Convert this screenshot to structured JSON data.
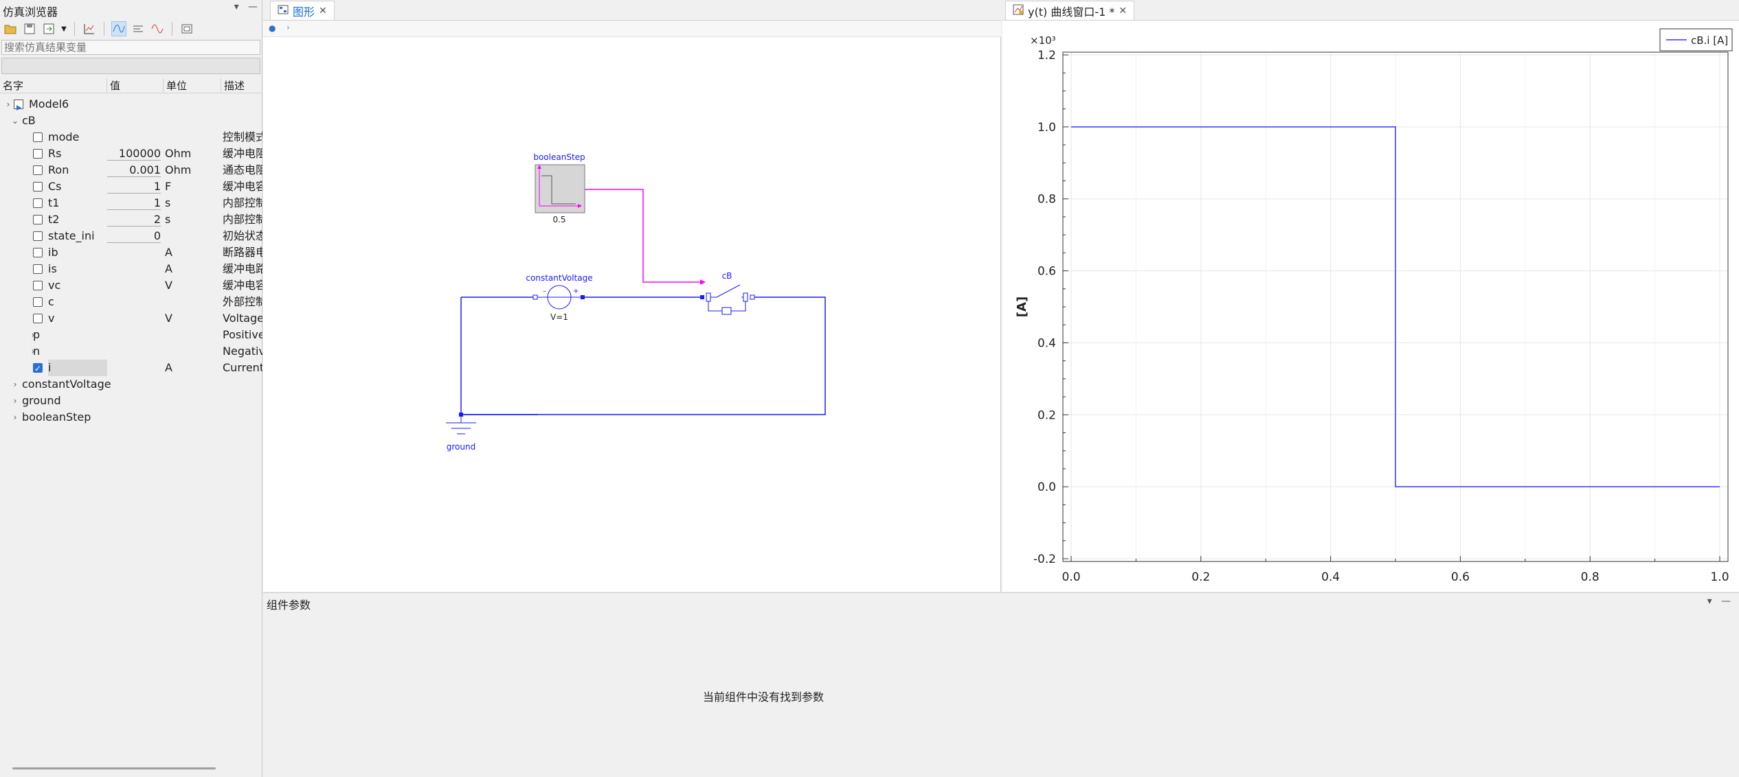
{
  "left_panel": {
    "title": "仿真浏览器",
    "search_placeholder": "搜索仿真结果变量",
    "columns": [
      "名字",
      "值",
      "单位",
      "描述"
    ],
    "tree": [
      {
        "level": 0,
        "arrow": "›",
        "name": "Model6",
        "icon": "model-icon"
      },
      {
        "level": 1,
        "arrow": "⌄",
        "name": "cB"
      },
      {
        "level": 2,
        "check": false,
        "name": "mode",
        "value": "",
        "unit": "",
        "desc": "控制模式"
      },
      {
        "level": 2,
        "check": false,
        "name": "Rs",
        "value": "100000",
        "unit": "Ohm",
        "desc": "缓冲电阻"
      },
      {
        "level": 2,
        "check": false,
        "name": "Ron",
        "value": "0.001",
        "unit": "Ohm",
        "desc": "通态电阻"
      },
      {
        "level": 2,
        "check": false,
        "name": "Cs",
        "value": "1",
        "unit": "F",
        "desc": "缓冲电容"
      },
      {
        "level": 2,
        "check": false,
        "name": "t1",
        "value": "1",
        "unit": "s",
        "desc": "内部控制"
      },
      {
        "level": 2,
        "check": false,
        "name": "t2",
        "value": "2",
        "unit": "s",
        "desc": "内部控制"
      },
      {
        "level": 2,
        "check": false,
        "name": "state_ini",
        "value": "0",
        "unit": "",
        "desc": "初始状态"
      },
      {
        "level": 2,
        "check": false,
        "name": "ib",
        "value": "",
        "unit": "A",
        "desc": "断路器电"
      },
      {
        "level": 2,
        "check": false,
        "name": "is",
        "value": "",
        "unit": "A",
        "desc": "缓冲电路"
      },
      {
        "level": 2,
        "check": false,
        "name": "vc",
        "value": "",
        "unit": "V",
        "desc": "缓冲电容"
      },
      {
        "level": 2,
        "check": false,
        "name": "c",
        "value": "",
        "unit": "",
        "desc": "外部控制"
      },
      {
        "level": 2,
        "check": false,
        "name": "v",
        "value": "",
        "unit": "V",
        "desc": "Voltage"
      },
      {
        "level": 2,
        "arrow": "›",
        "name": "p",
        "desc": "Positive"
      },
      {
        "level": 2,
        "arrow": "›",
        "name": "n",
        "desc": "Negativ"
      },
      {
        "level": 2,
        "check": true,
        "name": "i",
        "value": "",
        "unit": "A",
        "desc": "Current",
        "highlight": true
      },
      {
        "level": 1,
        "arrow": "›",
        "name": "constantVoltage"
      },
      {
        "level": 1,
        "arrow": "›",
        "name": "ground"
      },
      {
        "level": 1,
        "arrow": "›",
        "name": "booleanStep"
      }
    ]
  },
  "diagram": {
    "tab_label": "图形",
    "labels": {
      "booleanStep": "booleanStep",
      "booleanStep_param": "0.5",
      "constantVoltage": "constantVoltage",
      "constantVoltage_param": "V=1",
      "cB": "cB",
      "ground": "ground"
    },
    "colors": {
      "wire": "#1a1aff",
      "signal": "#ff00ff"
    }
  },
  "plot": {
    "tab_label": "y(t) 曲线窗口-1 *",
    "ylabel": "[A]",
    "exponent": "×10³",
    "legend": "cB.i [A]"
  },
  "chart_data": {
    "type": "line",
    "title": "",
    "xlabel": "",
    "ylabel": "[A]",
    "xlim": [
      0.0,
      1.0
    ],
    "ylim": [
      -0.2,
      1.2
    ],
    "xticks": [
      "0.0",
      "0.2",
      "0.4",
      "0.6",
      "0.8",
      "1.0"
    ],
    "yticks": [
      "-0.2",
      "0.0",
      "0.2",
      "0.4",
      "0.6",
      "0.8",
      "1.0",
      "1.2"
    ],
    "grid": true,
    "legend_position": "top-right",
    "series": [
      {
        "name": "cB.i [A]",
        "color": "#3333ff",
        "x": [
          0.0,
          0.5,
          0.5,
          1.0
        ],
        "y": [
          1.0,
          1.0,
          0.0,
          0.0
        ]
      }
    ]
  },
  "params_panel": {
    "title": "组件参数",
    "empty_text": "当前组件中没有找到参数"
  }
}
